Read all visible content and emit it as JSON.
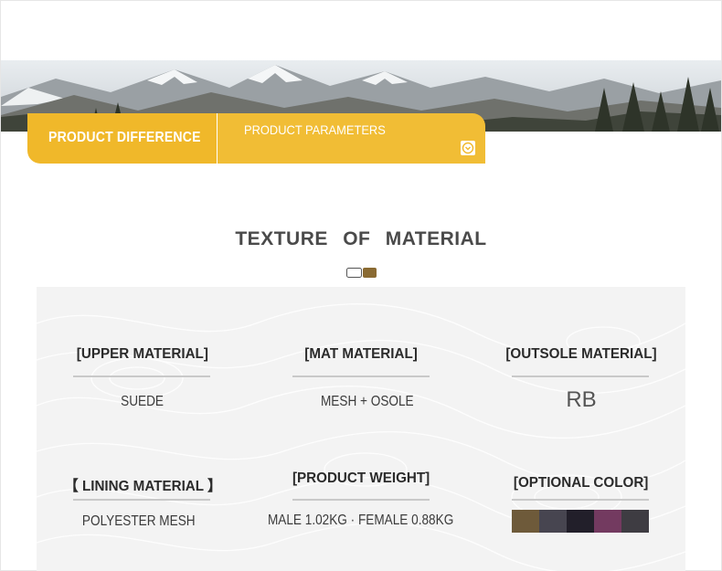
{
  "tabs": {
    "difference": "PRODUCT DIFFERENCE",
    "parameters": "PRODUCT PARAMETERS"
  },
  "section": {
    "title": "TEXTURE OF MATERIAL"
  },
  "materials": {
    "upper": {
      "label": "[UPPER MATERIAL]",
      "value": "SUEDE"
    },
    "mat": {
      "label": "[MAT MATERIAL]",
      "value": "MESH + OSOLE"
    },
    "outsole": {
      "label": "[OUTSOLE MATERIAL]",
      "value": "RB"
    },
    "lining": {
      "label": "【 LINING MATERIAL 】",
      "value": "POLYESTER MESH"
    },
    "weight": {
      "label": "[PRODUCT WEIGHT]",
      "value": "MALE 1.02KG · FEMALE 0.88KG"
    },
    "color": {
      "label": "[OPTIONAL COLOR]"
    }
  },
  "colors": {
    "accent": "#f0b82a",
    "swatches": [
      "#6e5a3a",
      "#474550",
      "#221f2a",
      "#733a60",
      "#3e3c42"
    ]
  },
  "icons": {
    "tab_arrow": "chevron-down-icon",
    "title_marker": "marker-icon"
  }
}
